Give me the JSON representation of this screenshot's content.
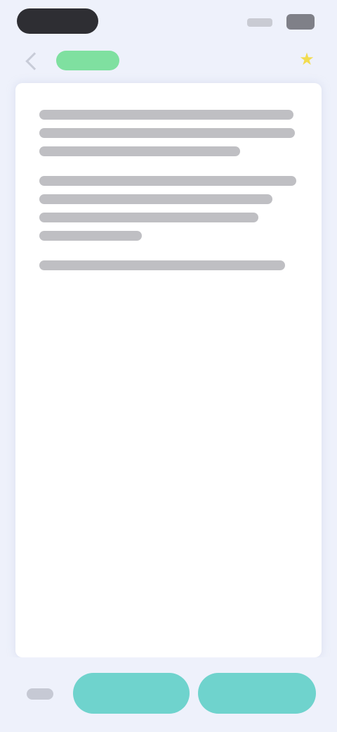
{
  "status_bar": {},
  "header": {
    "back_icon": "chevron-left-icon",
    "tag_color": "#7fe0a0",
    "star_icon": "star-icon",
    "star_color": "#f2dc4f"
  },
  "card": {
    "paragraphs": []
  },
  "bottom_bar": {
    "primary_color": "#6fd3cd",
    "left_button_label": "",
    "right_button_label": ""
  }
}
